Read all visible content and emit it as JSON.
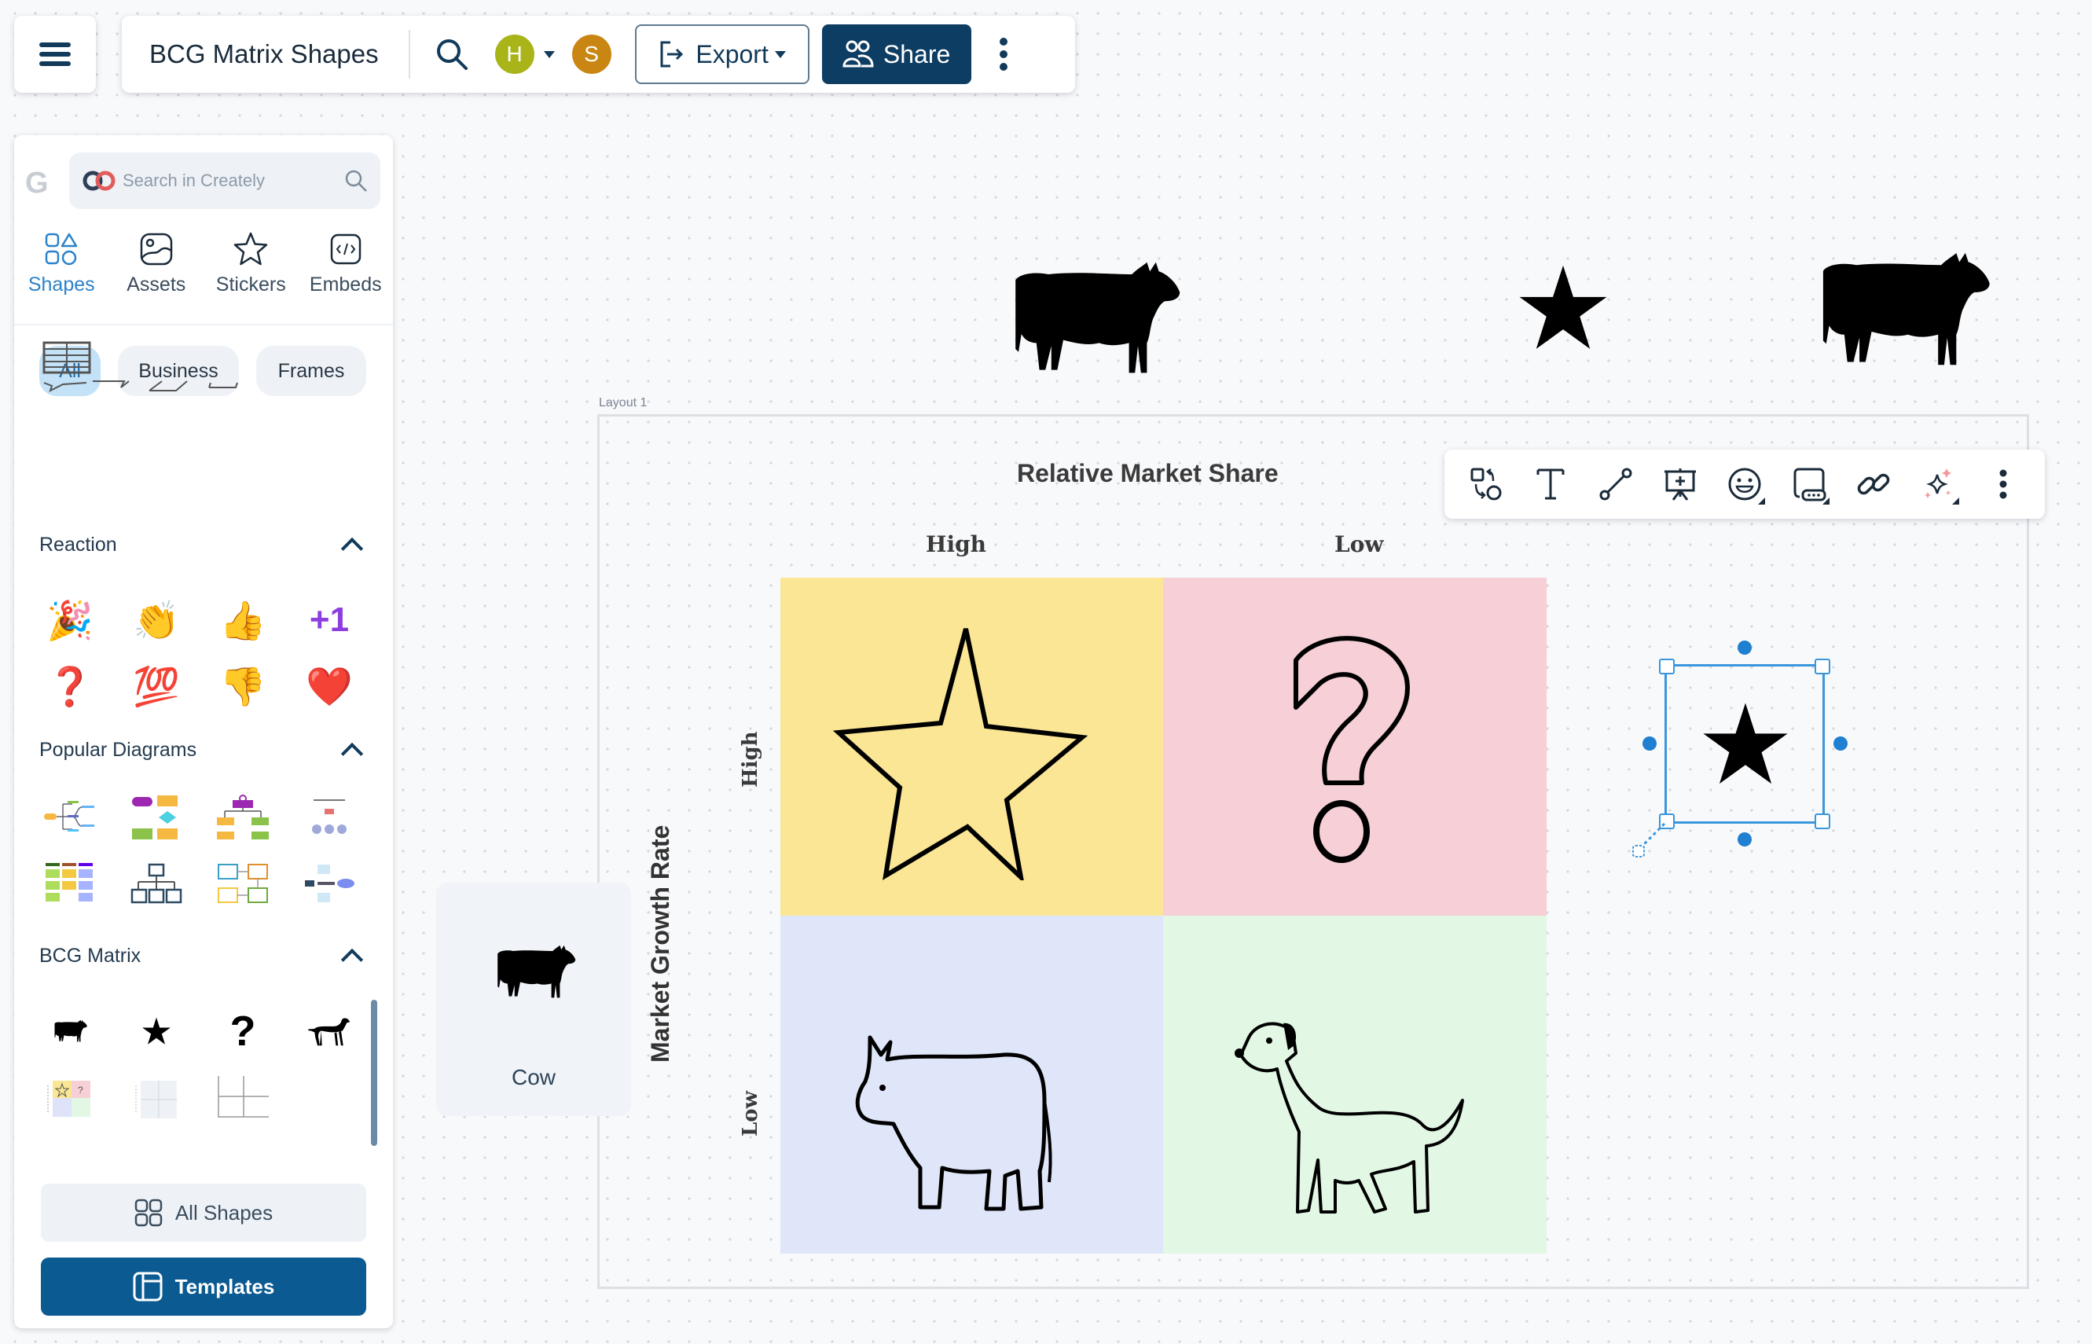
{
  "app": {
    "menu_icon": "hamburger-icon",
    "document_title": "BCG Matrix Shapes"
  },
  "topbar": {
    "search_icon": "search-icon",
    "collaborators": [
      {
        "initial": "H",
        "color": "#a9b419"
      },
      {
        "initial": "S",
        "color": "#c98613"
      }
    ],
    "export_label": "Export",
    "share_label": "Share",
    "more_icon": "more-vertical-icon"
  },
  "left_panel": {
    "search_placeholder": "Search in Creately",
    "tabs": [
      {
        "label": "Shapes",
        "icon": "shapes-icon",
        "active": true
      },
      {
        "label": "Assets",
        "icon": "image-icon",
        "active": false
      },
      {
        "label": "Stickers",
        "icon": "star-outline-icon",
        "active": false
      },
      {
        "label": "Embeds",
        "icon": "code-icon",
        "active": false
      }
    ],
    "filter_chips": [
      {
        "label": "All",
        "active": true
      },
      {
        "label": "Business",
        "active": false
      },
      {
        "label": "Frames",
        "active": false
      }
    ],
    "sections": {
      "reaction": {
        "title": "Reaction",
        "items": [
          "🎉",
          "👏",
          "👍",
          "+1",
          "❓",
          "💯",
          "👎",
          "❤️"
        ],
        "item_names": [
          "party-popper",
          "clapping-hands",
          "thumbs-up",
          "plus-one",
          "question-mark",
          "hundred-points",
          "thumbs-down",
          "red-heart"
        ]
      },
      "popular": {
        "title": "Popular Diagrams",
        "items": [
          "mind-map",
          "flowchart",
          "org-chart",
          "tree-diagram",
          "table-matrix",
          "hierarchy-chart",
          "process-flow",
          "network-diagram"
        ]
      },
      "bcg": {
        "title": "BCG Matrix",
        "items": [
          "cow",
          "star",
          "question-mark",
          "dog",
          "bcg-template-colored",
          "bcg-template-blank",
          "bcg-axes"
        ]
      }
    },
    "all_shapes_label": "All Shapes",
    "templates_label": "Templates"
  },
  "canvas": {
    "frame_label": "Layout 1",
    "matrix": {
      "x_axis_title": "Relative Market Share",
      "x_levels": [
        "High",
        "Low"
      ],
      "y_axis_title": "Market Growth Rate",
      "y_levels": [
        "High",
        "Low"
      ],
      "quadrants": [
        {
          "name": "Star",
          "color": "#fae695"
        },
        {
          "name": "Question Mark",
          "color": "#f6d0d6"
        },
        {
          "name": "Cash Cow",
          "color": "#e0e6fa"
        },
        {
          "name": "Dog",
          "color": "#e2f8e5"
        }
      ]
    },
    "loose_shapes": [
      "cow-silhouette",
      "star-solid",
      "cow-silhouette"
    ],
    "selected_shape": "star-solid",
    "drag_tooltip_label": "Cow"
  },
  "floating_toolbar": {
    "buttons": [
      "swap-shape",
      "text",
      "connector",
      "presentation-add",
      "emoji",
      "container",
      "link",
      "ai-sparkle",
      "more"
    ]
  },
  "colors": {
    "primary": "#0e3d63",
    "accent_blue": "#2b82c9",
    "selection": "#3a96dd"
  }
}
